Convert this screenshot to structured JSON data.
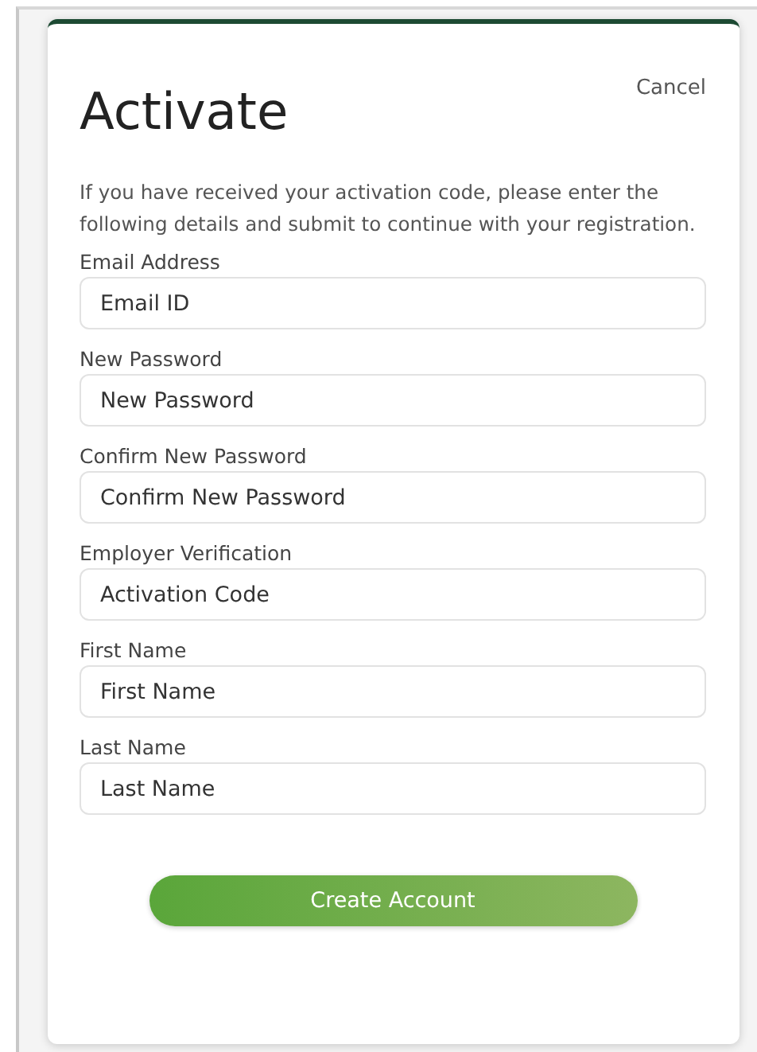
{
  "title": "Activate",
  "cancel": "Cancel",
  "intro": "If you have received your activation code, please enter the following details and submit to continue with your registration.",
  "fields": [
    {
      "label": "Email Address",
      "placeholder": "Email ID"
    },
    {
      "label": "New Password",
      "placeholder": "New Password"
    },
    {
      "label": "Confirm New Password",
      "placeholder": "Confirm New Password"
    },
    {
      "label": "Employer Verification",
      "placeholder": "Activation Code"
    },
    {
      "label": "First Name",
      "placeholder": "First Name"
    },
    {
      "label": "Last Name",
      "placeholder": "Last Name"
    }
  ],
  "submit": "Create Account"
}
